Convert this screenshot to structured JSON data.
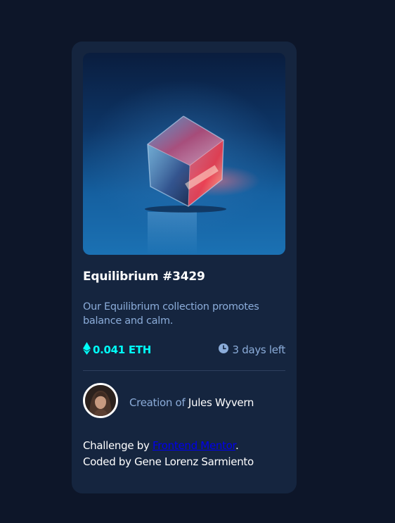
{
  "card": {
    "image_alt": "Equilibrium",
    "title": "Equilibrium #3429",
    "description": "Our Equilibrium collection promotes balance and calm.",
    "price": "0.041 ETH",
    "time_left": "3 days left",
    "creator_prefix": "Creation of",
    "creator_name": "Jules Wyvern"
  },
  "attribution": {
    "challenge_prefix": "Challenge by",
    "link_text": "Frontend Mentor",
    "period": ".",
    "coded_by": "Coded by Gene Lorenz Sarmiento"
  },
  "colors": {
    "page_background": "#0d1629",
    "card_background": "#15253f",
    "accent_cyan": "#00fff8",
    "soft_blue": "#8bacd9",
    "white": "#ffffff",
    "link": "#0000ee"
  },
  "icons": {
    "price": "ethereum-icon",
    "time": "clock-icon"
  }
}
